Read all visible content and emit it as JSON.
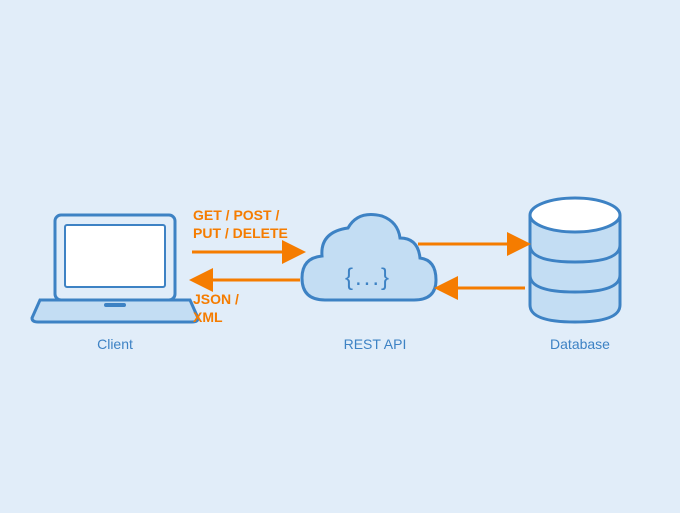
{
  "nodes": {
    "client": {
      "label": "Client"
    },
    "rest_api": {
      "label": "REST API",
      "symbol": "{...}"
    },
    "database": {
      "label": "Database"
    }
  },
  "arrows": {
    "request": {
      "line1": "GET / POST /",
      "line2": "PUT / DELETE"
    },
    "response": {
      "line1": "JSON /",
      "line2": "XML"
    }
  },
  "colors": {
    "accent": "#3d82c4",
    "light_fill": "#c3ddf3",
    "white_fill": "#ffffff",
    "arrow": "#f57c00",
    "bg": "#e1edf9"
  }
}
